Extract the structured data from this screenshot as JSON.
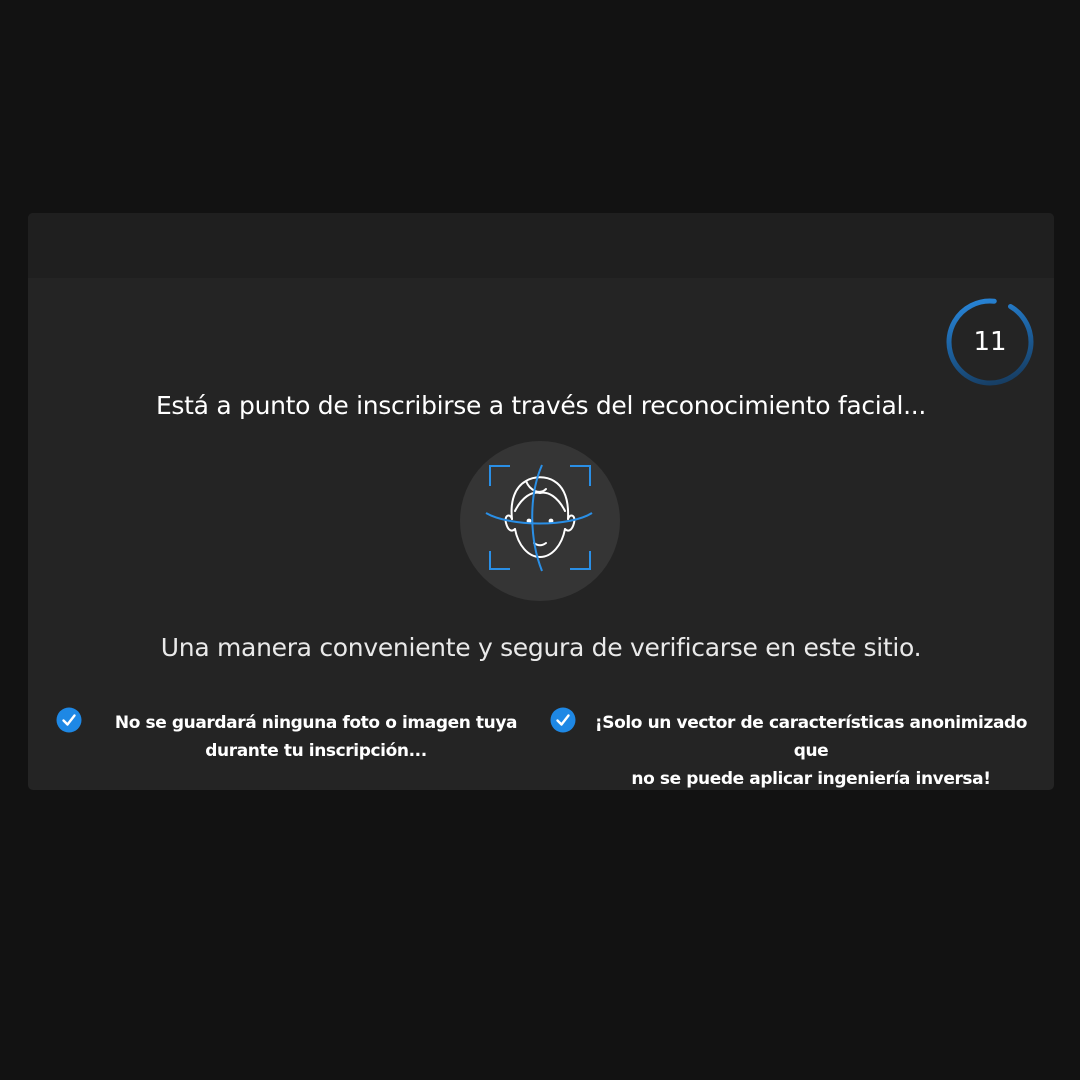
{
  "timer": {
    "seconds_remaining": "11"
  },
  "headline": "Está a punto de inscribirse a través del reconocimiento facial...",
  "face_graphic": {
    "icon": "face-scan-icon",
    "accent_color": "#2a8fe6"
  },
  "subline": "Una manera conveniente y segura de verificarse en este sitio.",
  "features": [
    {
      "icon": "check-circle-icon",
      "text_line1": "No se guardará ninguna foto o imagen tuya",
      "text_line2": "durante tu inscripción..."
    },
    {
      "icon": "check-circle-icon",
      "text_line1": "¡Solo un vector de características anonimizado que",
      "text_line2": "no se puede aplicar ingeniería inversa!"
    }
  ],
  "colors": {
    "background": "#121212",
    "card": "#242424",
    "accent": "#1e88e5"
  }
}
